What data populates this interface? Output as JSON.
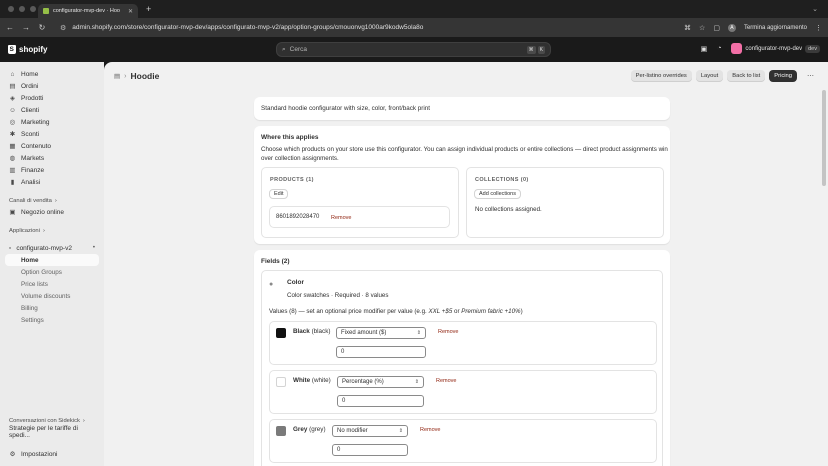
{
  "browser": {
    "tab_title": "configurator-mvp-dev · Hoo",
    "url": "admin.shopify.com/store/configurator-mvp-dev/apps/configurato-mvp-v2/app/option-groups/cmouonvg1000ar9kodw5ola8o",
    "restart_label": "Termina aggiornamento",
    "profile_initial": "A"
  },
  "topbar": {
    "brand": "shopify",
    "search_placeholder": "Cerca",
    "shortcut_keys": [
      "⌘",
      "K"
    ],
    "store_name": "configurator-mvp-dev",
    "store_badge": "dev"
  },
  "sidebar": {
    "items": [
      {
        "label": "Home",
        "icon": "home-icon"
      },
      {
        "label": "Ordini",
        "icon": "orders-icon"
      },
      {
        "label": "Prodotti",
        "icon": "products-icon"
      },
      {
        "label": "Clienti",
        "icon": "customers-icon"
      },
      {
        "label": "Marketing",
        "icon": "marketing-icon"
      },
      {
        "label": "Sconti",
        "icon": "discounts-icon"
      },
      {
        "label": "Contenuto",
        "icon": "content-icon"
      },
      {
        "label": "Markets",
        "icon": "markets-icon"
      },
      {
        "label": "Finanze",
        "icon": "finance-icon"
      },
      {
        "label": "Analisi",
        "icon": "analytics-icon"
      }
    ],
    "sales_channels_label": "Canali di vendita",
    "online_store_label": "Negozio online",
    "apps_label": "Applicazioni",
    "app_name": "configurato-mvp-v2",
    "app_subitems": [
      "Home",
      "Option Groups",
      "Price lists",
      "Volume discounts",
      "Billing",
      "Settings"
    ],
    "sidekick_label": "Conversazioni con Sidekick",
    "sidekick_item": "Strategie per le tariffe di spedi...",
    "settings_label": "Impostazioni"
  },
  "page": {
    "title": "Hoodie",
    "actions": [
      "Per-listino overrides",
      "Layout",
      "Back to list",
      "Pricing"
    ],
    "description": "Standard hoodie configurator with size, color, front/back print",
    "where_title": "Where this applies",
    "where_text_1": "Choose which products on your store use this configurator. You can assign individual products or entire collections — direct product assignments win",
    "where_text_2": "over collection assignments.",
    "products_heading": "PRODUCTS (1)",
    "products_edit": "Edit",
    "product_id": "8601892028470",
    "remove_label": "Remove",
    "collections_heading": "COLLECTIONS (0)",
    "add_collections": "Add collections",
    "no_collections": "No collections assigned.",
    "fields_heading": "Fields (2)",
    "field_name": "Color",
    "field_meta": "Color swatches · Required · 8 values",
    "values_note_prefix": "Values (8) — set an optional price modifier per value (e.g. ",
    "values_note_italic": "XXL +$5",
    "values_note_mid": " or ",
    "values_note_italic2": "Premium fabric +10%",
    "values_note_suffix": ")",
    "values": [
      {
        "name": "Black",
        "code": "(black)",
        "color": "#111111",
        "modifier": "Fixed amount ($)",
        "amount": "0"
      },
      {
        "name": "White",
        "code": "(white)",
        "color": "#ffffff",
        "modifier": "Percentage (%)",
        "amount": "0"
      },
      {
        "name": "Grey",
        "code": "(grey)",
        "color": "#7a7a7a",
        "modifier": "No modifier",
        "amount": "0"
      }
    ]
  }
}
